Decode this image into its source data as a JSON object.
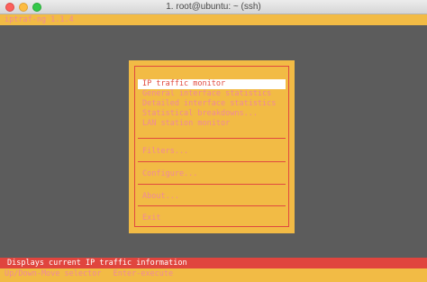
{
  "window": {
    "title": "1. root@ubuntu: ~ (ssh)"
  },
  "app": {
    "version_label": "iptraf-ng 1.1.4"
  },
  "menu": {
    "items": [
      {
        "label": "IP traffic monitor",
        "selected": true
      },
      {
        "label": "General interface statistics",
        "selected": false
      },
      {
        "label": "Detailed interface statistics",
        "selected": false
      },
      {
        "label": "Statistical breakdowns...",
        "selected": false
      },
      {
        "label": "LAN station monitor",
        "selected": false
      },
      {
        "label": "Filters...",
        "selected": false
      },
      {
        "label": "Configure...",
        "selected": false
      },
      {
        "label": "About...",
        "selected": false
      },
      {
        "label": "Exit",
        "selected": false
      }
    ]
  },
  "status": {
    "description": "Displays current IP traffic information"
  },
  "help": {
    "navigate": "Up/Down-Move selector",
    "select": "Enter-execute"
  },
  "colors": {
    "terminal_bg": "#5c5c5c",
    "panel_yellow": "#f2bb45",
    "accent_red": "#e0453e",
    "menu_text_pink": "#f08a9a",
    "selection_bg": "#ffffff"
  }
}
